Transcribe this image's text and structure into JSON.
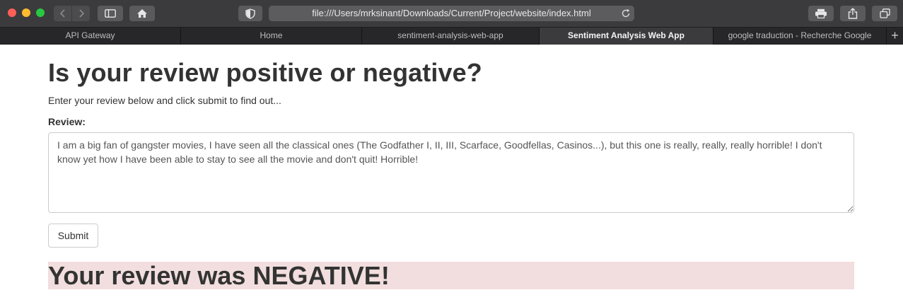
{
  "browser": {
    "url": "file:///Users/mrksinant/Downloads/Current/Project/website/index.html",
    "tabs": [
      {
        "label": "API Gateway",
        "active": false
      },
      {
        "label": "Home",
        "active": false
      },
      {
        "label": "sentiment-analysis-web-app",
        "active": false
      },
      {
        "label": "Sentiment Analysis Web App",
        "active": true
      },
      {
        "label": "google traduction - Recherche Google",
        "active": false
      }
    ],
    "new_tab_label": "+"
  },
  "page": {
    "title": "Is your review positive or negative?",
    "subtitle": "Enter your review below and click submit to find out...",
    "review_label": "Review:",
    "review_value": "I am a big fan of gangster movies, I have seen all the classical ones (The Godfather I, II, III, Scarface, Goodfellas, Casinos...), but this one is really, really, really horrible! I don't know yet how I have been able to stay to see all the movie and don't quit! Horrible!",
    "submit_label": "Submit",
    "result": "Your review was NEGATIVE!"
  },
  "colors": {
    "toolbar": "#3b3b3d",
    "result_background": "#f2dede",
    "text": "#333333"
  },
  "icons": [
    "back-icon",
    "forward-icon",
    "sidebar-icon",
    "home-icon",
    "shield-icon",
    "reload-icon",
    "print-icon",
    "share-icon",
    "tabs-overview-icon"
  ]
}
